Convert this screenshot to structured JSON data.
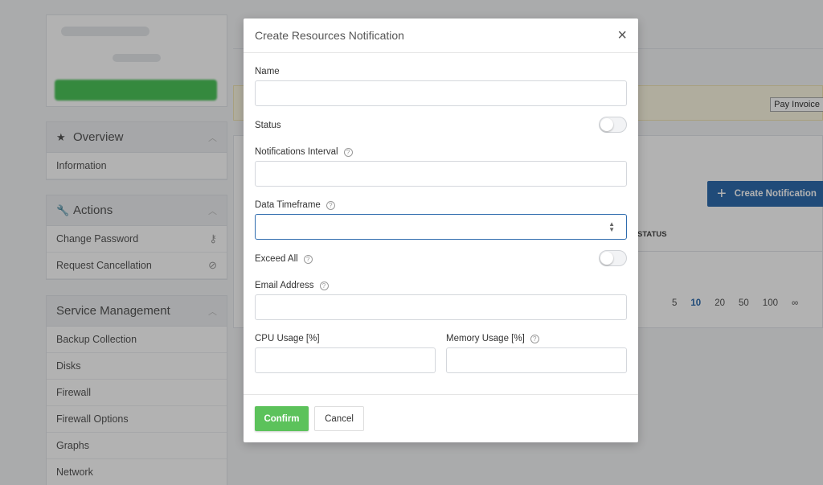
{
  "background": {
    "sidebar": {
      "overview": {
        "title": "Overview",
        "icon": "star-icon",
        "items": [
          "Information"
        ]
      },
      "actions": {
        "title": "Actions",
        "icon": "wrench-icon",
        "items": [
          {
            "label": "Change Password",
            "icon": "key-icon"
          },
          {
            "label": "Request Cancellation",
            "icon": "ban-icon"
          }
        ]
      },
      "service_management": {
        "title": "Service Management",
        "items": [
          "Backup Collection",
          "Disks",
          "Firewall",
          "Firewall Options",
          "Graphs",
          "Network"
        ]
      }
    },
    "pay_invoice_label": "Pay Invoice",
    "create_notification_label": "Create Notification",
    "table_header_status": "STATUS",
    "pager": [
      "5",
      "10",
      "20",
      "50",
      "100",
      "∞"
    ],
    "pager_active": "10"
  },
  "modal": {
    "title": "Create Resources Notification",
    "close": "×",
    "fields": {
      "name": {
        "label": "Name",
        "value": ""
      },
      "status": {
        "label": "Status",
        "on": false
      },
      "interval": {
        "label": "Notifications Interval",
        "value": ""
      },
      "timeframe": {
        "label": "Data Timeframe",
        "value": ""
      },
      "exceed_all": {
        "label": "Exceed All",
        "on": false
      },
      "email": {
        "label": "Email Address",
        "value": ""
      },
      "cpu": {
        "label": "CPU Usage [%]",
        "value": ""
      },
      "memory": {
        "label": "Memory Usage [%]",
        "value": ""
      }
    },
    "confirm_label": "Confirm",
    "cancel_label": "Cancel"
  },
  "colors": {
    "primary": "#2f6cae",
    "confirm": "#5cc25b",
    "alert_bg": "#fcf8e3"
  }
}
